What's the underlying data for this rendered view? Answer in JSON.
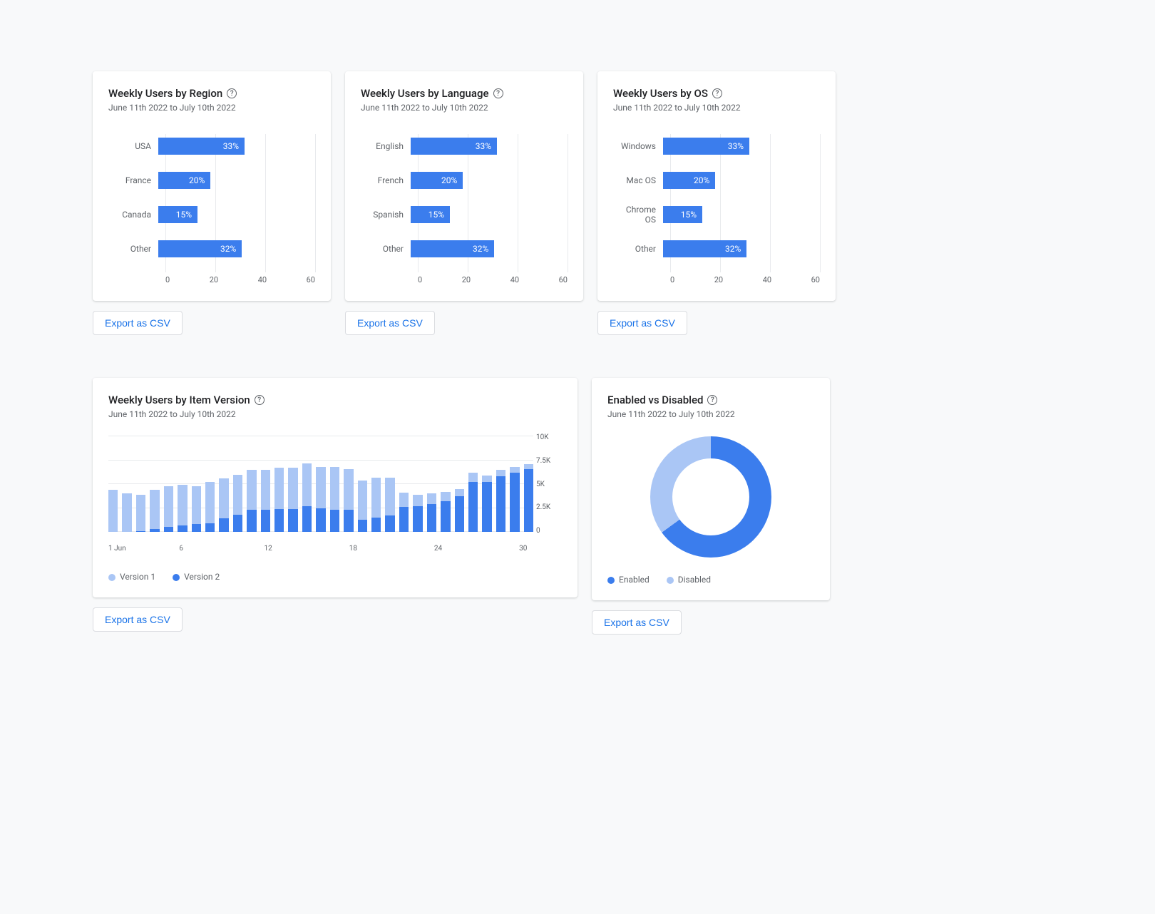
{
  "date_range": "June 11th 2022 to July 10th 2022",
  "export_label": "Export as CSV",
  "cards": {
    "region": {
      "title": "Weekly Users by Region"
    },
    "language": {
      "title": "Weekly Users by Language"
    },
    "os": {
      "title": "Weekly Users by OS"
    },
    "version": {
      "title": "Weekly Users by Item Version"
    },
    "enabled": {
      "title": "Enabled vs Disabled"
    }
  },
  "legend": {
    "version1": "Version 1",
    "version2": "Version 2",
    "enabled": "Enabled",
    "disabled": "Disabled"
  },
  "chart_data": [
    {
      "id": "region",
      "type": "bar",
      "orientation": "horizontal",
      "categories": [
        "USA",
        "France",
        "Canada",
        "Other"
      ],
      "values": [
        33,
        20,
        15,
        32
      ],
      "value_suffix": "%",
      "xlim": [
        0,
        60
      ],
      "xticks": [
        0,
        20,
        40,
        60
      ],
      "title": "Weekly Users by Region"
    },
    {
      "id": "language",
      "type": "bar",
      "orientation": "horizontal",
      "categories": [
        "English",
        "French",
        "Spanish",
        "Other"
      ],
      "values": [
        33,
        20,
        15,
        32
      ],
      "value_suffix": "%",
      "xlim": [
        0,
        60
      ],
      "xticks": [
        0,
        20,
        40,
        60
      ],
      "title": "Weekly Users by Language"
    },
    {
      "id": "os",
      "type": "bar",
      "orientation": "horizontal",
      "categories": [
        "Windows",
        "Mac OS",
        "Chrome OS",
        "Other"
      ],
      "values": [
        33,
        20,
        15,
        32
      ],
      "value_suffix": "%",
      "xlim": [
        0,
        60
      ],
      "xticks": [
        0,
        20,
        40,
        60
      ],
      "title": "Weekly Users by OS"
    },
    {
      "id": "version",
      "type": "bar",
      "orientation": "vertical",
      "stacked": true,
      "x_start": "1 Jun",
      "x_ticks_shown": [
        "1 Jun",
        "6",
        "12",
        "18",
        "24",
        "30"
      ],
      "series": [
        {
          "name": "Version 1",
          "values": [
            4400,
            4000,
            3800,
            4100,
            4300,
            4200,
            4000,
            4300,
            4200,
            4200,
            4200,
            4200,
            4300,
            4300,
            4500,
            4300,
            4500,
            4300,
            4100,
            4200,
            4000,
            1500,
            1200,
            1100,
            1000,
            800,
            1000,
            700,
            700,
            600,
            500
          ]
        },
        {
          "name": "Version 2",
          "values": [
            0,
            0,
            100,
            300,
            500,
            700,
            800,
            900,
            1400,
            1800,
            2300,
            2300,
            2400,
            2400,
            2700,
            2500,
            2300,
            2300,
            1300,
            1500,
            1700,
            2600,
            2700,
            2900,
            3200,
            3700,
            5200,
            5200,
            5800,
            6200,
            6600
          ]
        }
      ],
      "ylim": [
        0,
        10000
      ],
      "yticks": [
        0,
        2500,
        5000,
        7500,
        10000
      ],
      "ytick_labels": [
        "0",
        "2.5K",
        "5K",
        "7.5K",
        "10K"
      ],
      "title": "Weekly Users by Item Version"
    },
    {
      "id": "enabled",
      "type": "pie",
      "donut": true,
      "categories": [
        "Enabled",
        "Disabled"
      ],
      "values": [
        65,
        35
      ],
      "colors": [
        "#3b7ded",
        "#aac6f5"
      ],
      "title": "Enabled vs Disabled"
    }
  ]
}
